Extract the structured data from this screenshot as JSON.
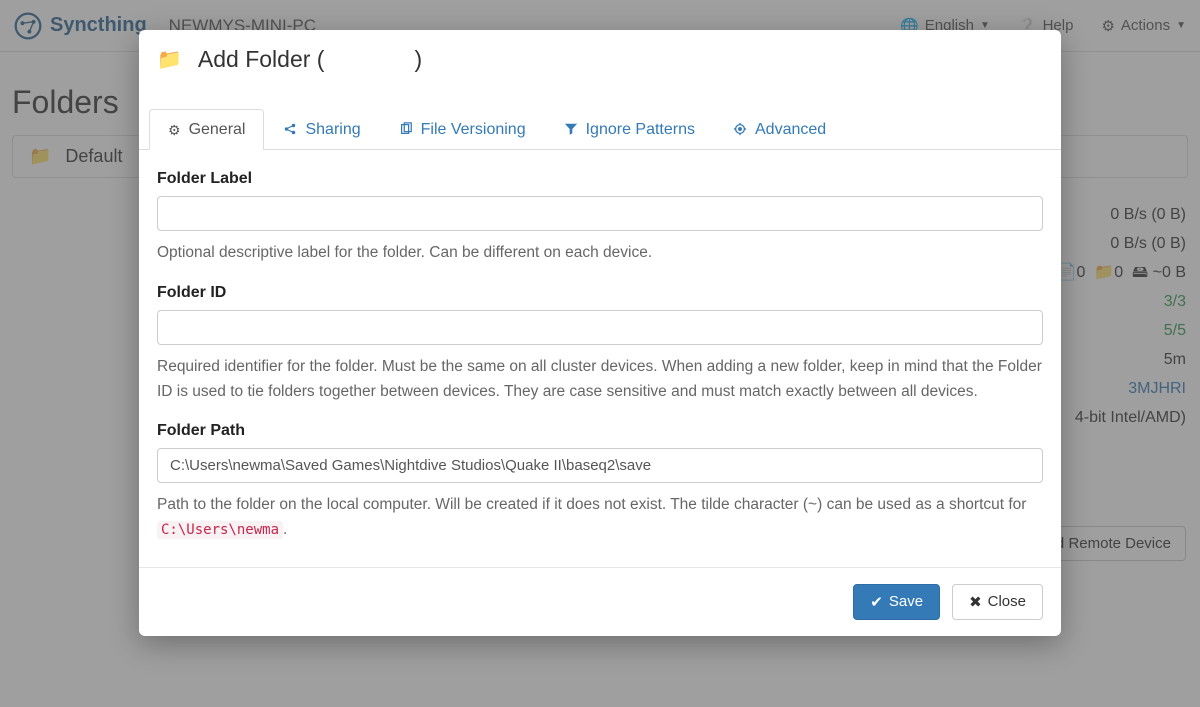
{
  "brand": "Syncthing",
  "device_name": "NEWMYS-MINI-PC",
  "nav": {
    "language": "English",
    "help": "Help",
    "actions": "Actions"
  },
  "folders_title": "Folders",
  "default_folder_label": "Default",
  "sidebar": {
    "rate1": "0 B/s (0 B)",
    "rate2": "0 B/s (0 B)",
    "stats_files": "0",
    "stats_folders": "0",
    "stats_size": "~0 B",
    "listeners": "3/3",
    "discovery": "5/5",
    "uptime": "5m",
    "id_suffix": "3MJHRI",
    "platform": "4-bit Intel/AMD)"
  },
  "add_remote_btn": "dd Remote Device",
  "modal": {
    "title_prefix": "Add Folder (",
    "title_suffix": ")",
    "tabs": {
      "general": "General",
      "sharing": "Sharing",
      "versioning": "File Versioning",
      "ignore": "Ignore Patterns",
      "advanced": "Advanced"
    },
    "label": {
      "title": "Folder Label",
      "value": "",
      "help": "Optional descriptive label for the folder. Can be different on each device."
    },
    "id": {
      "title": "Folder ID",
      "value": "",
      "help": "Required identifier for the folder. Must be the same on all cluster devices. When adding a new folder, keep in mind that the Folder ID is used to tie folders together between devices. They are case sensitive and must match exactly between all devices."
    },
    "path": {
      "title": "Folder Path",
      "value": "C:\\Users\\newma\\Saved Games\\Nightdive Studios\\Quake II\\baseq2\\save",
      "help_prefix": "Path to the folder on the local computer. Will be created if it does not exist. The tilde character (~) can be used as a shortcut for ",
      "help_code": "C:\\Users\\newma",
      "help_suffix": "."
    },
    "save": "Save",
    "close": "Close"
  }
}
